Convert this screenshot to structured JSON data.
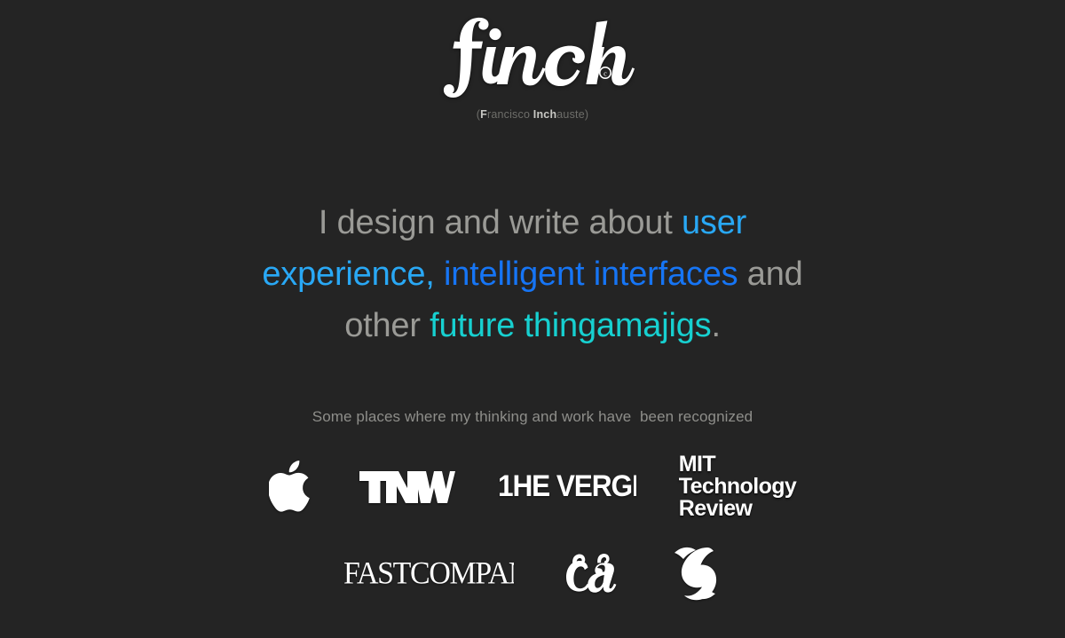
{
  "brand": {
    "logo_text": "finch",
    "logo_icon": "finch-script-wordmark",
    "copyright_mark": "©",
    "subtitle_prefix": "(",
    "subtitle_f": "F",
    "subtitle_mid1": "rancisco ",
    "subtitle_inch": "Inch",
    "subtitle_mid2": "auste",
    "subtitle_suffix": ")",
    "subtitle_full": "(Francisco Inchauste)"
  },
  "headline": {
    "part1": "I design and write about ",
    "user": "user experience,",
    "user_a": "user",
    "user_b": "experience,",
    "intelligent": "intelligent interfaces",
    "and": " and ",
    "other": "other ",
    "future": "future thingamajigs",
    "period": ".",
    "full_text": "I design and write about user experience, intelligent interfaces and other future thingamajigs.",
    "colors": {
      "base": "#9a9a96",
      "blue": "#29a8f5",
      "deep_blue": "#1675f5",
      "teal": "#17d0d0"
    }
  },
  "recognition": {
    "label": "Some places where my thinking and work have  been recognized",
    "rows": [
      [
        {
          "name": "apple",
          "label": "Apple",
          "icon": "apple-logo"
        },
        {
          "name": "tnw",
          "label": "TNW",
          "icon": "tnw-wordmark"
        },
        {
          "name": "the-verge",
          "label": "THE VERGE",
          "icon": "the-verge-wordmark"
        },
        {
          "name": "mit-technology-review",
          "label": "MIT Technology Review",
          "icon": "mit-technology-review-wordmark",
          "line1": "MIT",
          "line2": "Technology",
          "line3": "Review"
        }
      ],
      [
        {
          "name": "fast-company",
          "label": "FAST COMPANY",
          "icon": "fast-company-wordmark"
        },
        {
          "name": "communication-arts",
          "label": "ca",
          "icon": "communication-arts-logo"
        },
        {
          "name": "smashing-magazine",
          "label": "S",
          "icon": "smashing-magazine-logo"
        }
      ]
    ]
  },
  "theme": {
    "background": "#242424",
    "logo_white": "#ffffff",
    "muted_text": "#8e8e8a",
    "dim_text": "#6e6e6a"
  }
}
